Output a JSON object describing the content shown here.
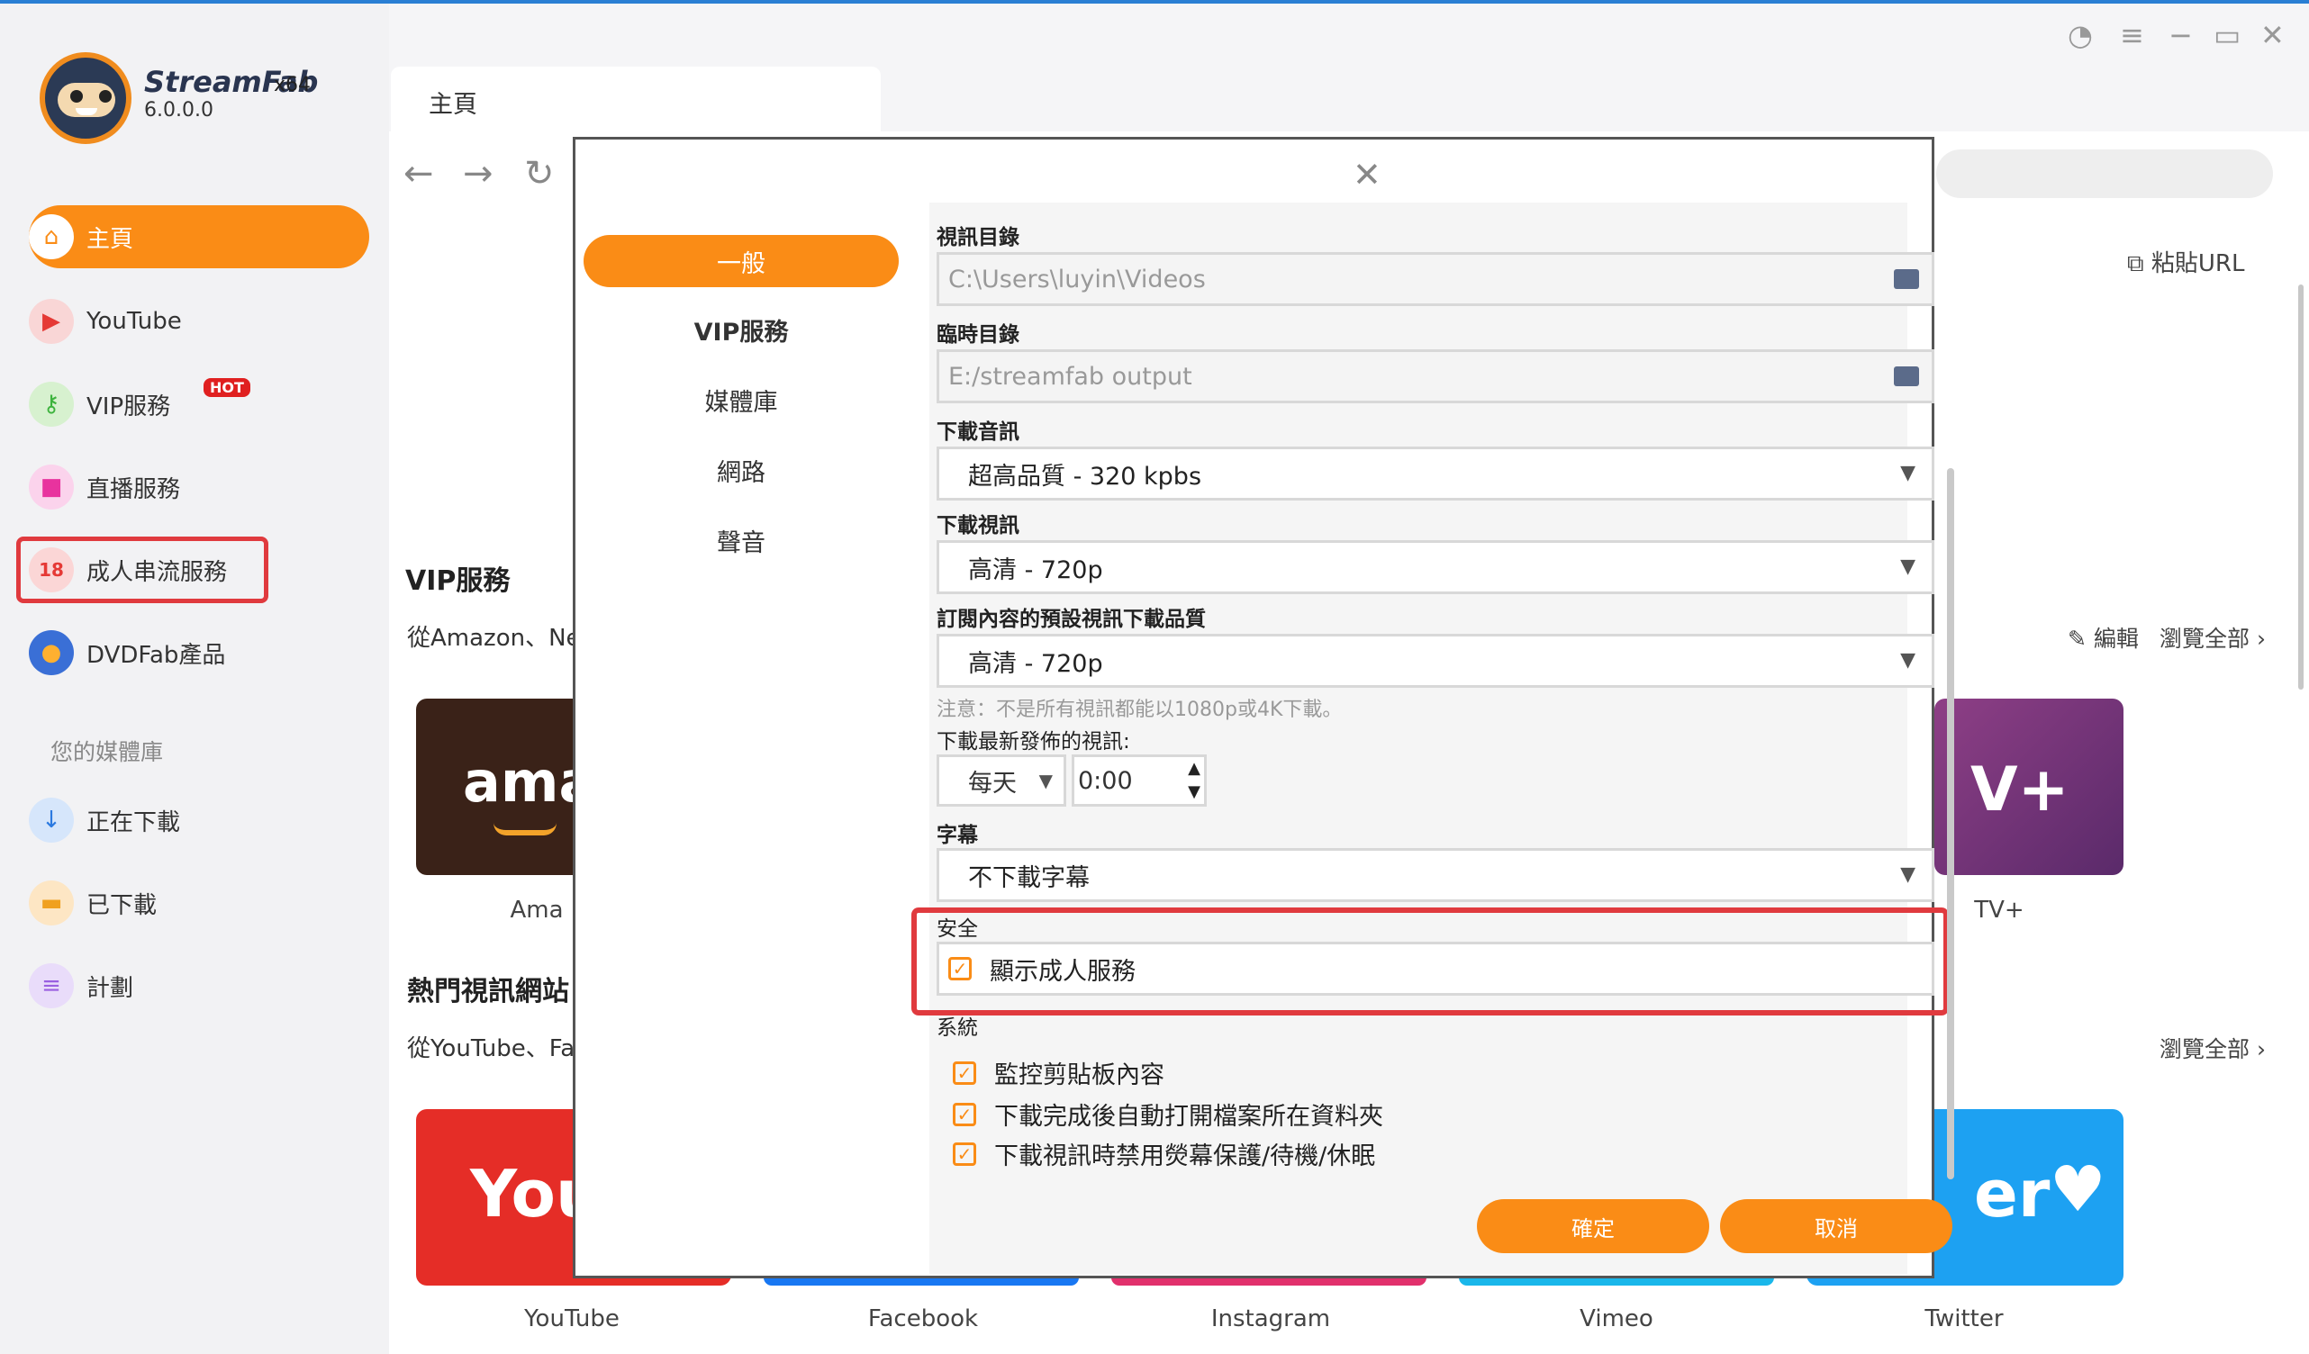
{
  "app": {
    "name": "StreamFab",
    "arch": "x64",
    "version": "6.0.0.0"
  },
  "sidebar": {
    "items": [
      {
        "label": "主頁",
        "icon": "home-icon"
      },
      {
        "label": "YouTube",
        "icon": "youtube-icon"
      },
      {
        "label": "VIP服務",
        "icon": "key-icon",
        "badge": "HOT"
      },
      {
        "label": "直播服務",
        "icon": "live-camera-icon"
      },
      {
        "label": "成人串流服務",
        "icon": "adult-18-icon"
      },
      {
        "label": "DVDFab產品",
        "icon": "dvdfab-icon"
      }
    ],
    "library_label": "您的媒體庫",
    "library_items": [
      {
        "label": "正在下載",
        "icon": "download-icon"
      },
      {
        "label": "已下載",
        "icon": "folder-icon"
      },
      {
        "label": "計劃",
        "icon": "schedule-icon"
      }
    ]
  },
  "tab": {
    "label": "主頁"
  },
  "toolbar": {
    "paste_url": "粘貼URL"
  },
  "vip_section": {
    "title": "VIP服務",
    "desc_visible": "從Amazon、Ne",
    "edit_label": "編輯",
    "browse_all": "瀏覽全部",
    "cards": [
      {
        "label": "Ama",
        "logo_text": "ama"
      },
      {
        "label": "TV+",
        "logo_text": "V+"
      }
    ]
  },
  "hot_section": {
    "title": "熱門視訊網站",
    "title_visible": "熱門視訊網站",
    "desc_visible": "從YouTube、Fa",
    "browse_all": "瀏覽全部",
    "cards": [
      {
        "label": "YouTube",
        "logo_text": "You"
      },
      {
        "label": "Facebook"
      },
      {
        "label": "Instagram"
      },
      {
        "label": "Vimeo"
      },
      {
        "label": "Twitter",
        "logo_text": "er"
      }
    ]
  },
  "dialog": {
    "menu": [
      "一般",
      "VIP服務",
      "媒體庫",
      "網路",
      "聲音"
    ],
    "video_dir_label": "視訊目錄",
    "video_dir_value": "C:\\Users\\luyin\\Videos",
    "temp_dir_label": "臨時目錄",
    "temp_dir_value": "E:/streamfab output",
    "audio_label": "下載音訊",
    "audio_value": "超高品質 - 320 kpbs",
    "video_label": "下載視訊",
    "video_value": "高清 - 720p",
    "sub_quality_label": "訂閱內容的預設視訊下載品質",
    "sub_quality_value": "高清 - 720p",
    "note": "注意：不是所有視訊都能以1080p或4K下載。",
    "latest_label": "下載最新發佈的視訊:",
    "latest_freq": "每天",
    "latest_time": "0:00",
    "subtitle_label": "字幕",
    "subtitle_value": "不下載字幕",
    "security_label": "安全",
    "security_option": "顯示成人服務",
    "system_label": "系統",
    "system_options": [
      "監控剪貼板內容",
      "下載完成後自動打開檔案所在資料夾",
      "下載視訊時禁用熒幕保護/待機/休眠"
    ],
    "ok": "確定",
    "cancel": "取消"
  },
  "colors": {
    "accent": "#fa8c16",
    "highlight": "#e03a3e",
    "title_bar": "#2a7fd4"
  }
}
